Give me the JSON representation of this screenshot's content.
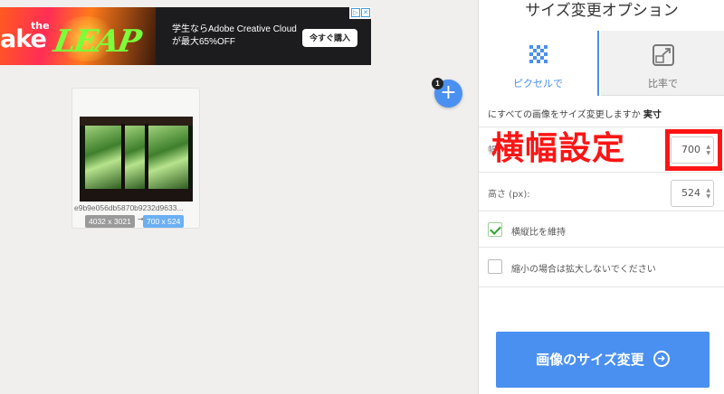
{
  "ad": {
    "brand_make": "ake",
    "brand_the": "the",
    "brand_leap": "LEAP",
    "line1": "学生ならAdobe Creative Cloud",
    "line2": "が最大65%OFF",
    "button": "今すぐ購入"
  },
  "image_card": {
    "filename": "e9b9e056db5870b9232d9633...",
    "original_size": "4032 x 3021",
    "arrow": "→",
    "new_size": "700 x 524"
  },
  "add": {
    "symbol": "+",
    "count": "1"
  },
  "panel": {
    "title": "サイズ変更オプション",
    "tabs": [
      {
        "label": "ピクセルで",
        "icon": "pixels-icon",
        "active": true
      },
      {
        "label": "比率で",
        "icon": "ratio-icon",
        "active": false
      }
    ],
    "apply_all_text": "にすべての画像をサイズ変更しますか",
    "apply_all_value": "実寸",
    "width_label": "幅",
    "width_overlay": "横幅設定",
    "width_value": "700",
    "height_label": "高さ (px):",
    "height_value": "524",
    "keep_ratio_label": "横縦比を維持",
    "keep_ratio_checked": true,
    "no_enlarge_label": "縮小の場合は拡大しないでください",
    "no_enlarge_checked": false,
    "submit_label": "画像のサイズ変更"
  },
  "colors": {
    "accent": "#4a90f0",
    "highlight": "#ff1414",
    "check": "#2aa62a"
  }
}
